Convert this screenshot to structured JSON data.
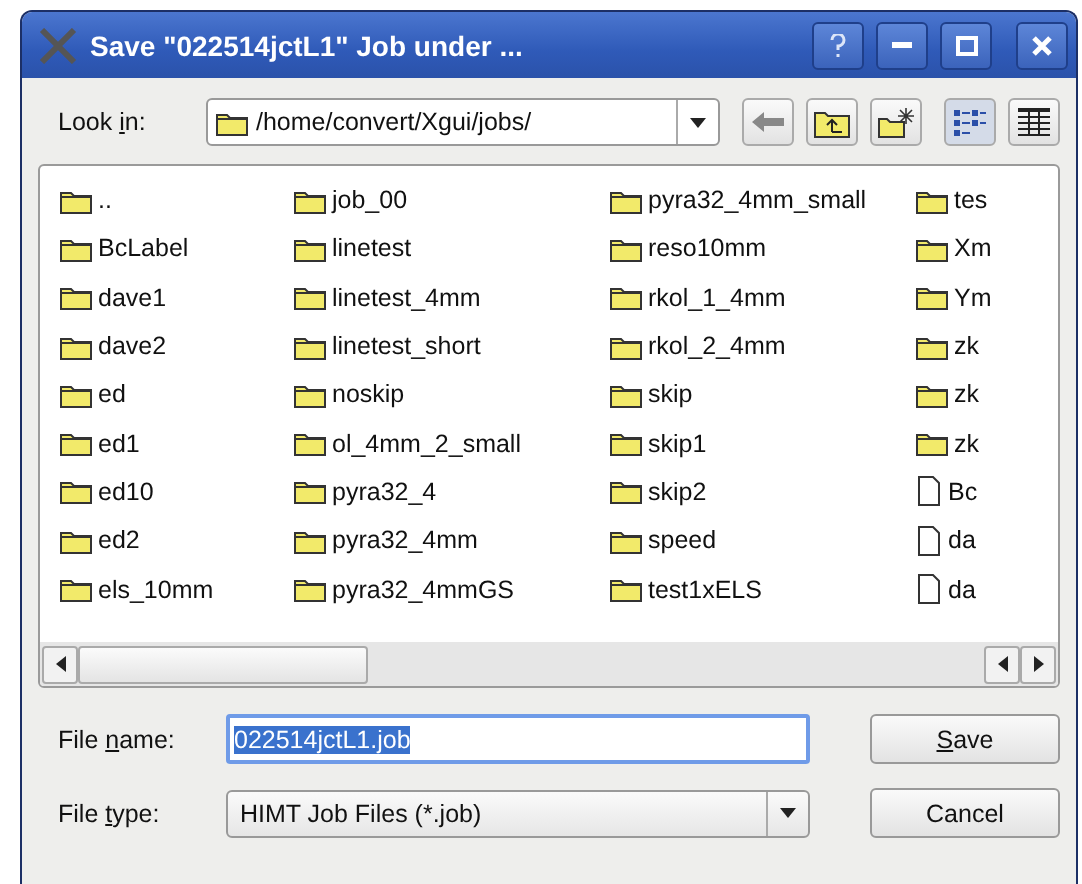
{
  "window": {
    "title": "Save \"022514jctL1\" Job under ..."
  },
  "look_in": {
    "label_start": "Look ",
    "accel": "i",
    "label_end": "n:",
    "path": "/home/convert/Xgui/jobs/"
  },
  "view_buttons": [
    {
      "kind": "list",
      "selected": true
    },
    {
      "kind": "detail",
      "selected": false
    }
  ],
  "files": [
    {
      "name": "..",
      "kind": "folder"
    },
    {
      "name": "BcLabel",
      "kind": "folder"
    },
    {
      "name": "dave1",
      "kind": "folder"
    },
    {
      "name": "dave2",
      "kind": "folder"
    },
    {
      "name": "ed",
      "kind": "folder"
    },
    {
      "name": "ed1",
      "kind": "folder"
    },
    {
      "name": "ed10",
      "kind": "folder"
    },
    {
      "name": "ed2",
      "kind": "folder"
    },
    {
      "name": "els_10mm",
      "kind": "folder"
    },
    {
      "name": "job_00",
      "kind": "folder"
    },
    {
      "name": "linetest",
      "kind": "folder"
    },
    {
      "name": "linetest_4mm",
      "kind": "folder"
    },
    {
      "name": "linetest_short",
      "kind": "folder"
    },
    {
      "name": "noskip",
      "kind": "folder"
    },
    {
      "name": "ol_4mm_2_small",
      "kind": "folder"
    },
    {
      "name": "pyra32_4",
      "kind": "folder"
    },
    {
      "name": "pyra32_4mm",
      "kind": "folder"
    },
    {
      "name": "pyra32_4mmGS",
      "kind": "folder"
    },
    {
      "name": "pyra32_4mm_small",
      "kind": "folder"
    },
    {
      "name": "reso10mm",
      "kind": "folder"
    },
    {
      "name": "rkol_1_4mm",
      "kind": "folder"
    },
    {
      "name": "rkol_2_4mm",
      "kind": "folder"
    },
    {
      "name": "skip",
      "kind": "folder"
    },
    {
      "name": "skip1",
      "kind": "folder"
    },
    {
      "name": "skip2",
      "kind": "folder"
    },
    {
      "name": "speed",
      "kind": "folder"
    },
    {
      "name": "test1xELS",
      "kind": "folder"
    },
    {
      "name": "tes",
      "kind": "folder"
    },
    {
      "name": "Xm",
      "kind": "folder"
    },
    {
      "name": "Ym",
      "kind": "folder"
    },
    {
      "name": "zk",
      "kind": "folder"
    },
    {
      "name": "zk",
      "kind": "folder"
    },
    {
      "name": "zk",
      "kind": "folder"
    },
    {
      "name": "Bc",
      "kind": "file"
    },
    {
      "name": "da",
      "kind": "file"
    },
    {
      "name": "da",
      "kind": "file"
    }
  ],
  "file_name": {
    "label_start": "File ",
    "accel": "n",
    "label_end": "ame:",
    "value": "022514jctL1.job",
    "text_selected": true
  },
  "file_type": {
    "label_start": "File ",
    "accel": "t",
    "label_end": "ype:",
    "value": "HIMT Job Files (*.job)"
  },
  "buttons": [
    {
      "accel": "S",
      "label_end": "ave"
    },
    {
      "label_start": "Cancel"
    }
  ]
}
